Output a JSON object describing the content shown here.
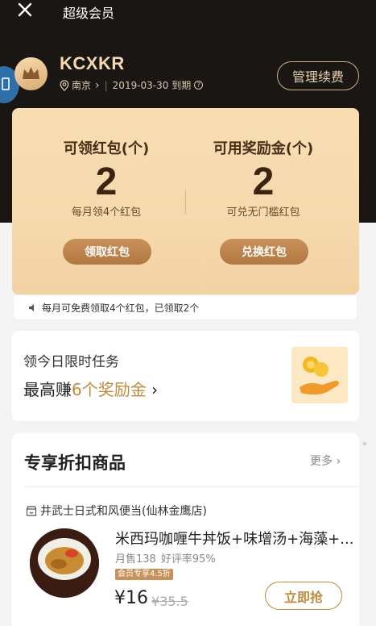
{
  "header": {
    "title": "超级会员",
    "username": "KCXKR",
    "city": "南京",
    "city_chevron": "›",
    "expire_text": "2019-03-30 到期",
    "help_icon": "?",
    "manage_label": "管理续费"
  },
  "stats": {
    "left": {
      "label": "可领红包(个)",
      "value": "2",
      "sub": "每月领4个红包",
      "button": "领取红包"
    },
    "right": {
      "label": "可用奖励金(个)",
      "value": "2",
      "sub": "可兑无门槛红包",
      "button": "兑换红包"
    }
  },
  "notice": "每月可免费领取4个红包，已领取2个",
  "task": {
    "title": "领今日限时任务",
    "prefix": "最高赚",
    "highlight": "6个奖励金",
    "suffix": " ›"
  },
  "goods": {
    "title": "专享折扣商品",
    "more": "更多 ›",
    "shop": "井武士日式和风便当(仙林金鹰店)",
    "item": {
      "name": "米西玛咖喱牛丼饭+味增汤+海藻+...",
      "sales": "月售138",
      "rating": "好评率95%",
      "badge": "会员专享4.5折",
      "price": "¥16",
      "original_price": "¥35.5",
      "buy_label": "立即抢"
    }
  },
  "colors": {
    "header_bg": "#1a1614",
    "gold_card": "#f6d9ad",
    "accent": "#c08a3e",
    "button_gold": "#b97f47"
  }
}
